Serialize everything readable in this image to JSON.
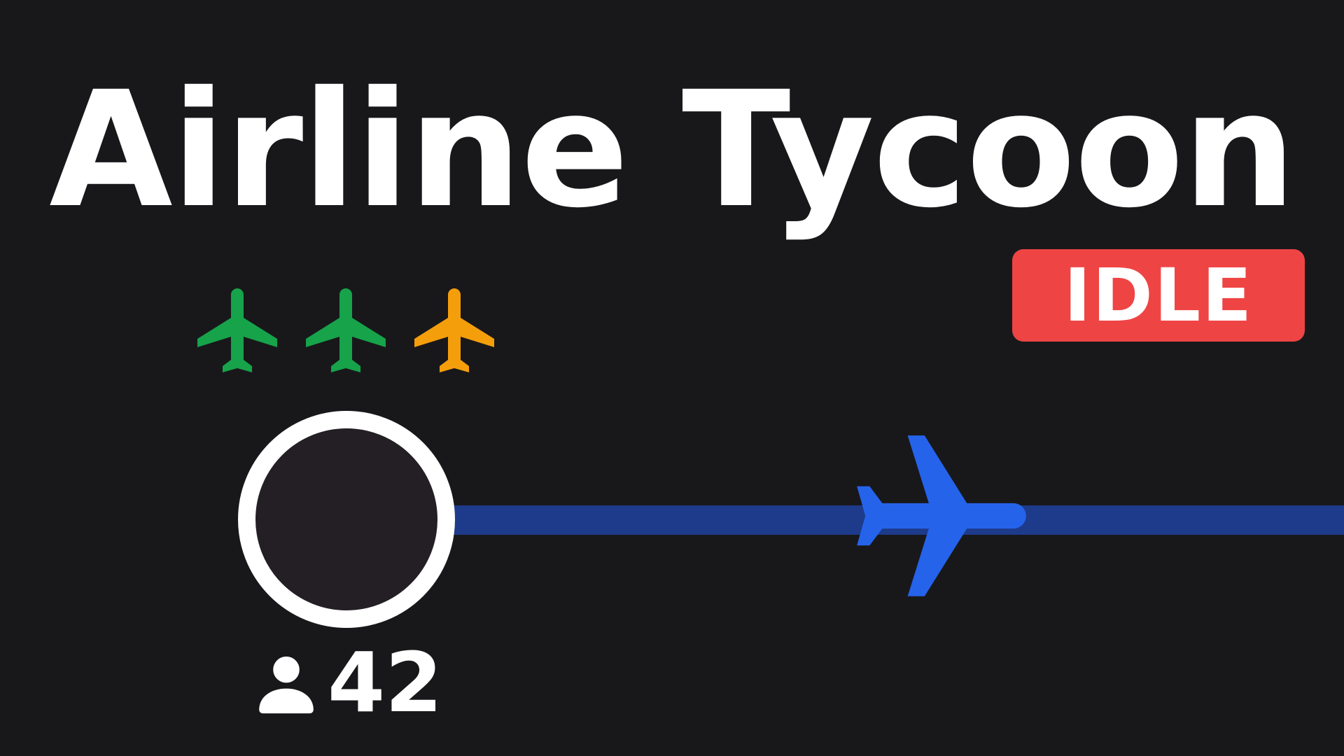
{
  "game": {
    "title": "Airline Tycoon",
    "status": "IDLE",
    "status_color": "#ef4444"
  },
  "airport": {
    "passengers": "42",
    "passenger_icon": "person-icon",
    "ring_color": "#ffffff",
    "fill_color": "#231f24"
  },
  "fleet": {
    "plane_icon": "airplane-icon",
    "planes": [
      {
        "color": "#16a34a"
      },
      {
        "color": "#16a34a"
      },
      {
        "color": "#f59e0b"
      }
    ]
  },
  "route": {
    "line_color": "#1e3a8a",
    "plane_color": "#2563eb"
  }
}
